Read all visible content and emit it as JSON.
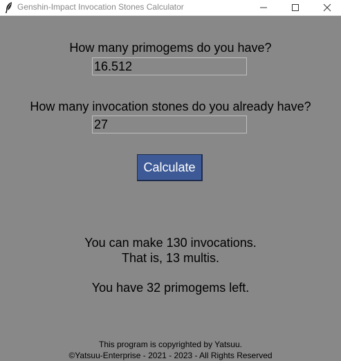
{
  "window": {
    "title": "Genshin-Impact Invocation Stones Calculator",
    "controls": [
      "minimize-icon",
      "maximize-icon",
      "close-icon"
    ],
    "icon": "feather-icon"
  },
  "form": {
    "primogems_label": "How many primogems do you have?",
    "primogems_value": "16.512",
    "stones_label": "How many invocation stones do you already have?",
    "stones_value": "27",
    "calculate_label": "Calculate"
  },
  "result": {
    "invocations_line": "You can make 130 invocations.",
    "multis_line": "That is, 13 multis.",
    "remaining_line": "You have 32 primogems left."
  },
  "footer": {
    "copyright_line1": "This program is copyrighted by Yatsuu.",
    "copyright_line2": "©Yatsuu-Enterprise - 2021 - 2023 - All Rights Reserved"
  },
  "colors": {
    "background": "#888888",
    "button": "#3e5a96",
    "button_text": "#ffffff",
    "text": "#000000"
  }
}
